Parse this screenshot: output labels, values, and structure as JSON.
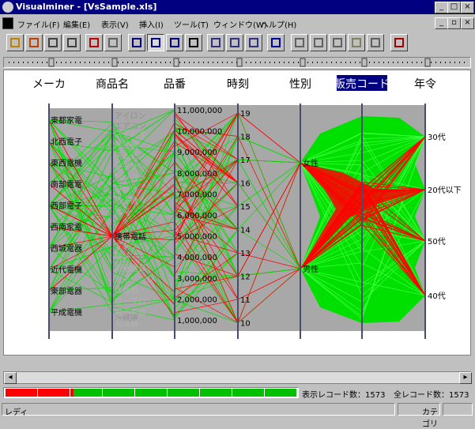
{
  "window": {
    "title": "Visualminer - [VsSample.xls]"
  },
  "menu": [
    "ファイル(F)",
    "編集(E)",
    "表示(V)",
    "挿入(I)",
    "ツール(T)",
    "ウィンドウ(W)",
    "ヘルプ(H)"
  ],
  "toolbar_icons": [
    "open-icon",
    "import-icon",
    "save-icon",
    "print-icon",
    "bar-chart-icon",
    "form-icon",
    "parallel-coords-icon",
    "parallel-coords-active-icon",
    "mesh-icon",
    "table-icon",
    "zoom-icon",
    "zoom-out-icon",
    "filter-icon",
    "cluster-icon",
    "grid-icon",
    "window-icon",
    "brush-icon",
    "export-icon",
    "doc-icon",
    "version-icon"
  ],
  "colors": {
    "green": "#00e000",
    "red": "#ff0000",
    "axis": "#4a4a6a",
    "gray_band": "#a8a8a8",
    "selected": "#000080"
  },
  "parallel": {
    "axes": [
      "メーカ",
      "商品名",
      "品番",
      "時刻",
      "性別",
      "販売コード",
      "年令"
    ],
    "selected_axis": "販売コード",
    "maker_labels": [
      "東都家電",
      "北西電子",
      "東西電機",
      "南部電電",
      "西部電子",
      "西南家電",
      "西城電器",
      "近代電機",
      "東部電器",
      "平成電機"
    ],
    "product_labels": [
      "アイロン",
      "エアコン",
      "携帯電話",
      "冷蔵庫"
    ],
    "product_gray_labels": [
      "ステレオ",
      "掃除機",
      "テレビ",
      "ビデオ",
      "パソコン",
      "ラジオ",
      "洗濯機",
      "電卓",
      "ミシン",
      "時計",
      "照明器具",
      "電子レンジ",
      "炊飯器",
      "ワープロ",
      "電子手帳",
      "電話機"
    ],
    "part_labels": [
      "11,000,000",
      "10,000,000",
      "9,000,000",
      "8,000,000",
      "7,000,000",
      "6,000,000",
      "5,000,000",
      "4,000,000",
      "3,000,000",
      "2,000,000",
      "1,000,000"
    ],
    "time_labels": [
      "19",
      "18",
      "17",
      "16",
      "15",
      "14",
      "13",
      "12",
      "11",
      "10"
    ],
    "gender_labels": [
      "女性",
      "男性"
    ],
    "age_labels": [
      "30代",
      "20代以下",
      "50代",
      "40代"
    ]
  },
  "status": {
    "shown_records": "表示レコード数：1573",
    "total_records": "全レコード数：1573",
    "ready": "レディ",
    "category": "カテゴリ"
  }
}
